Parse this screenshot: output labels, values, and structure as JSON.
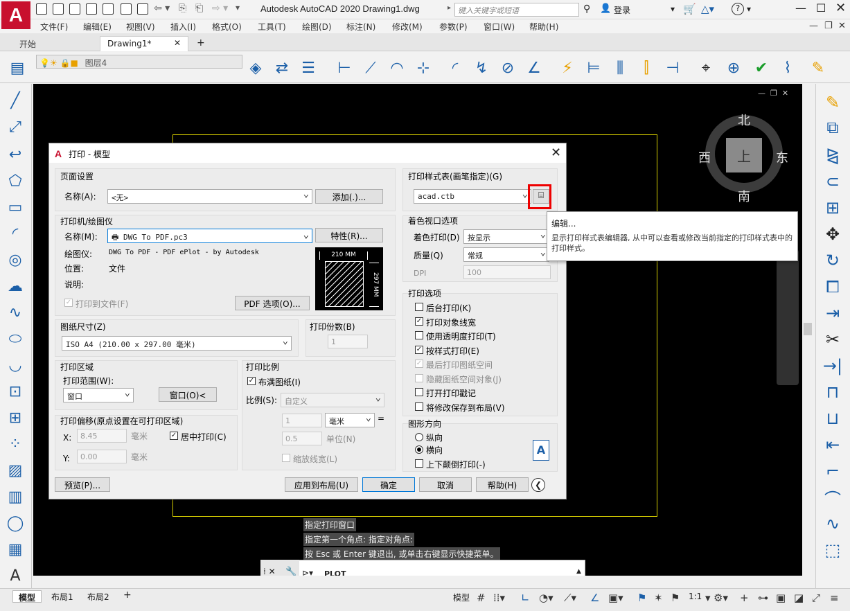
{
  "app": {
    "logo": "A",
    "title": "Autodesk AutoCAD 2020    Drawing1.dwg",
    "search_placeholder": "键入关键字或短语",
    "login": "登录",
    "help": "?"
  },
  "menu": [
    "文件(F)",
    "编辑(E)",
    "视图(V)",
    "插入(I)",
    "格式(O)",
    "工具(T)",
    "绘图(D)",
    "标注(N)",
    "修改(M)",
    "参数(P)",
    "窗口(W)",
    "帮助(H)"
  ],
  "tabs": {
    "start": "开始",
    "drawing": "Drawing1*",
    "add": "+"
  },
  "ribbon": {
    "layer_name": "图层4"
  },
  "viewcube": {
    "north": "北",
    "south": "南",
    "east": "东",
    "west": "西",
    "face": "上"
  },
  "command": {
    "history": [
      "指定打印窗口",
      "指定第一个角点: 指定对角点:",
      "按 Esc 或 Enter 键退出, 或单击右键显示快捷菜单。"
    ],
    "current": "PLOT"
  },
  "status": {
    "model_tab": "模型",
    "layout1": "布局1",
    "layout2": "布局2",
    "model_btn": "模型",
    "scale": "1:1"
  },
  "dialog": {
    "title": "打印 - 模型",
    "page_setup": {
      "group": "页面设置",
      "name_label": "名称(A):",
      "name_value": "<无>",
      "add_button": "添加(.)..."
    },
    "printer": {
      "group": "打印机/绘图仪",
      "name_label": "名称(M):",
      "name_value": "DWG To PDF.pc3",
      "properties_button": "特性(R)...",
      "plotter_label": "绘图仪:",
      "plotter_value": "DWG To PDF - PDF ePlot - by Autodesk",
      "location_label": "位置:",
      "location_value": "文件",
      "desc_label": "说明:",
      "plot_to_file": "打印到文件(F)",
      "pdf_options_button": "PDF 选项(O)...",
      "preview_width": "210 MM",
      "preview_height": "297 MM"
    },
    "paper_size": {
      "group": "图纸尺寸(Z)",
      "value": "ISO A4 (210.00 x 297.00 毫米)"
    },
    "copies": {
      "group": "打印份数(B)",
      "value": "1"
    },
    "plot_area": {
      "group": "打印区域",
      "range_label": "打印范围(W):",
      "range_value": "窗口",
      "window_button": "窗口(O)<"
    },
    "plot_offset": {
      "group": "打印偏移(原点设置在可打印区域)",
      "x_label": "X:",
      "x_value": "8.45",
      "y_label": "Y:",
      "y_value": "0.00",
      "unit": "毫米",
      "center": "居中打印(C)"
    },
    "plot_scale": {
      "group": "打印比例",
      "fit": "布满图纸(I)",
      "scale_label": "比例(S):",
      "scale_value": "自定义",
      "num": "1",
      "unit_value": "毫米",
      "equals": "=",
      "denom": "0.5",
      "unit_label": "单位(N)",
      "scale_lineweights": "缩放线宽(L)"
    },
    "plot_style": {
      "group": "打印样式表(画笔指定)(G)",
      "value": "acad.ctb"
    },
    "shaded": {
      "group": "着色视口选项",
      "shade_label": "着色打印(D)",
      "shade_value": "按显示",
      "quality_label": "质量(Q)",
      "quality_value": "常规",
      "dpi_label": "DPI",
      "dpi_value": "100"
    },
    "options": {
      "group": "打印选项",
      "items": [
        {
          "label": "后台打印(K)",
          "checked": false,
          "enabled": true
        },
        {
          "label": "打印对象线宽",
          "checked": true,
          "enabled": true
        },
        {
          "label": "使用透明度打印(T)",
          "checked": false,
          "enabled": true
        },
        {
          "label": "按样式打印(E)",
          "checked": true,
          "enabled": true
        },
        {
          "label": "最后打印图纸空间",
          "checked": true,
          "enabled": false
        },
        {
          "label": "隐藏图纸空间对象(J)",
          "checked": false,
          "enabled": false
        },
        {
          "label": "打开打印戳记",
          "checked": false,
          "enabled": true
        },
        {
          "label": "将修改保存到布局(V)",
          "checked": false,
          "enabled": true
        }
      ]
    },
    "orientation": {
      "group": "图形方向",
      "portrait": "纵向",
      "landscape": "横向",
      "upside_down": "上下颠倒打印(-)",
      "icon": "A"
    },
    "buttons": {
      "preview": "预览(P)...",
      "apply": "应用到布局(U)",
      "ok": "确定",
      "cancel": "取消",
      "help": "帮助(H)"
    },
    "tooltip": {
      "title": "编辑...",
      "body": "显示打印样式表编辑器, 从中可以查看或修改当前指定的打印样式表中的打印样式。"
    }
  }
}
